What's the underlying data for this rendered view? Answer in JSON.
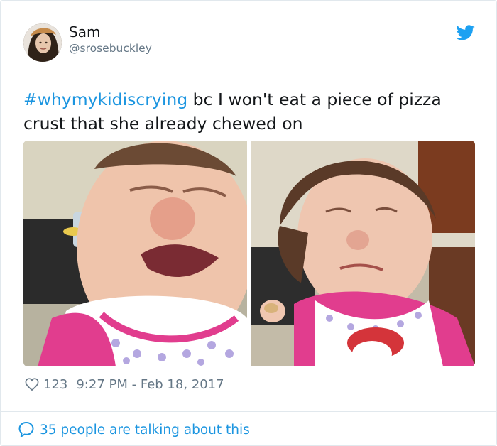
{
  "user": {
    "name": "Sam",
    "handle": "@srosebuckley"
  },
  "tweet": {
    "hashtag": "#whymykidiscrying",
    "text": " bc I won't eat a piece of pizza crust that she already chewed on"
  },
  "media": {
    "photos": [
      "photo-crying-toddler-closeup",
      "photo-crying-toddler-holding-crust"
    ]
  },
  "meta": {
    "likes": "123",
    "timestamp": "9:27 PM - Feb 18, 2017"
  },
  "footer": {
    "talking": "35 people are talking about this"
  },
  "colors": {
    "link": "#1b95e0",
    "secondary_text": "#657786",
    "border": "#e1e8ed"
  },
  "icons": [
    "twitter-bird-icon",
    "heart-icon",
    "speech-bubble-icon"
  ]
}
